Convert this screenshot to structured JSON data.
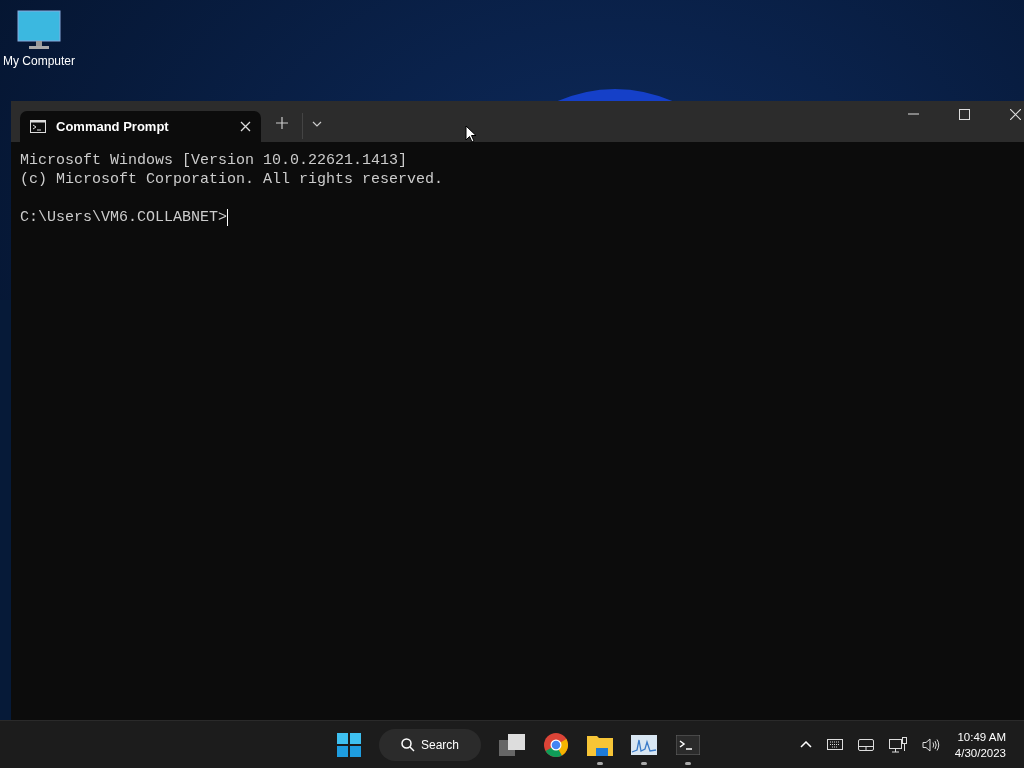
{
  "desktop_icons": [
    {
      "label": "My Computer"
    }
  ],
  "window": {
    "tabs": [
      {
        "title": "Command Prompt",
        "selected": true
      }
    ],
    "console_lines": [
      {
        "kind": "text",
        "text": "Microsoft Windows [Version 10.0.22621.1413]"
      },
      {
        "kind": "text",
        "text": "(c) Microsoft Corporation. All rights reserved."
      },
      {
        "kind": "blank"
      },
      {
        "kind": "prompt",
        "text": "C:\\Users\\VM6.COLLABNET>"
      }
    ]
  },
  "taskbar": {
    "search": {
      "label": "Search"
    },
    "apps": [
      {
        "kind": "taskview"
      },
      {
        "kind": "chrome"
      },
      {
        "kind": "explorer",
        "running": true
      },
      {
        "kind": "monitor",
        "running": true
      },
      {
        "kind": "terminal",
        "running": true
      }
    ],
    "clock": {
      "time": "10:49 AM",
      "date": "4/30/2023"
    }
  }
}
